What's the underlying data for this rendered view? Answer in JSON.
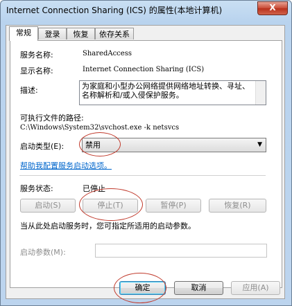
{
  "window": {
    "title": "Internet Connection Sharing (ICS) 的属性(本地计算机)",
    "close_label": "X"
  },
  "tabs": [
    {
      "label": "常规"
    },
    {
      "label": "登录"
    },
    {
      "label": "恢复"
    },
    {
      "label": "依存关系"
    }
  ],
  "general": {
    "service_name_label": "服务名称:",
    "service_name": "SharedAccess",
    "display_name_label": "显示名称:",
    "display_name": "Internet Connection Sharing (ICS)",
    "description_label": "描述:",
    "description": "为家庭和小型办公网络提供网络地址转换、寻址、名称解析和/或入侵保护服务。",
    "exec_path_label": "可执行文件的路径:",
    "exec_path": "C:\\Windows\\System32\\svchost.exe -k netsvcs",
    "startup_type_label": "启动类型(E):",
    "startup_type": "禁用",
    "help_link": "帮助我配置服务启动选项。",
    "status_label": "服务状态:",
    "status": "已停止",
    "start_button": "启动(S)",
    "stop_button": "停止(T)",
    "pause_button": "暂停(P)",
    "resume_button": "恢复(R)",
    "hint": "当从此处启动服务时，您可指定所适用的启动参数。",
    "params_label": "启动参数(M):",
    "params_value": ""
  },
  "footer": {
    "ok": "确定",
    "cancel": "取消",
    "apply": "应用(A)"
  },
  "colors": {
    "annotation": "#c0392b",
    "link": "#0066cc"
  }
}
